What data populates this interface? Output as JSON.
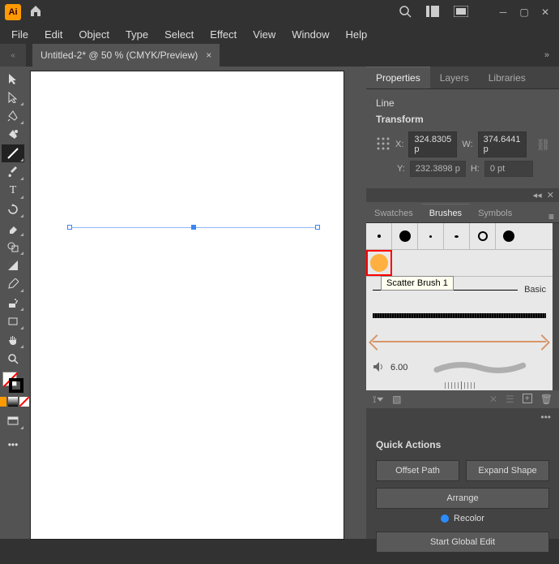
{
  "titlebar": {
    "app": "Ai",
    "home": "⌂"
  },
  "menu": {
    "file": "File",
    "edit": "Edit",
    "object": "Object",
    "type": "Type",
    "select": "Select",
    "effect": "Effect",
    "view": "View",
    "window": "Window",
    "help": "Help"
  },
  "tab": {
    "title": "Untitled-2* @ 50 % (CMYK/Preview)",
    "close": "×"
  },
  "properties": {
    "tabs": {
      "properties": "Properties",
      "layers": "Layers",
      "libraries": "Libraries"
    },
    "selection": "Line",
    "transform": {
      "title": "Transform",
      "x_label": "X:",
      "x": "324.8305 p",
      "w_label": "W:",
      "w": "374.6441 p",
      "y_label": "Y:",
      "y": "232.3898 p",
      "h_label": "H:",
      "h": "0 pt"
    }
  },
  "brushes": {
    "tabs": {
      "swatches": "Swatches",
      "brushes": "Brushes",
      "symbols": "Symbols"
    },
    "tooltip": "Scatter Brush 1",
    "basic": "Basic",
    "stroke_size": "6.00"
  },
  "quick": {
    "title": "Quick Actions",
    "offset": "Offset Path",
    "expand": "Expand Shape",
    "arrange": "Arrange",
    "recolor": "Recolor",
    "global": "Start Global Edit"
  }
}
